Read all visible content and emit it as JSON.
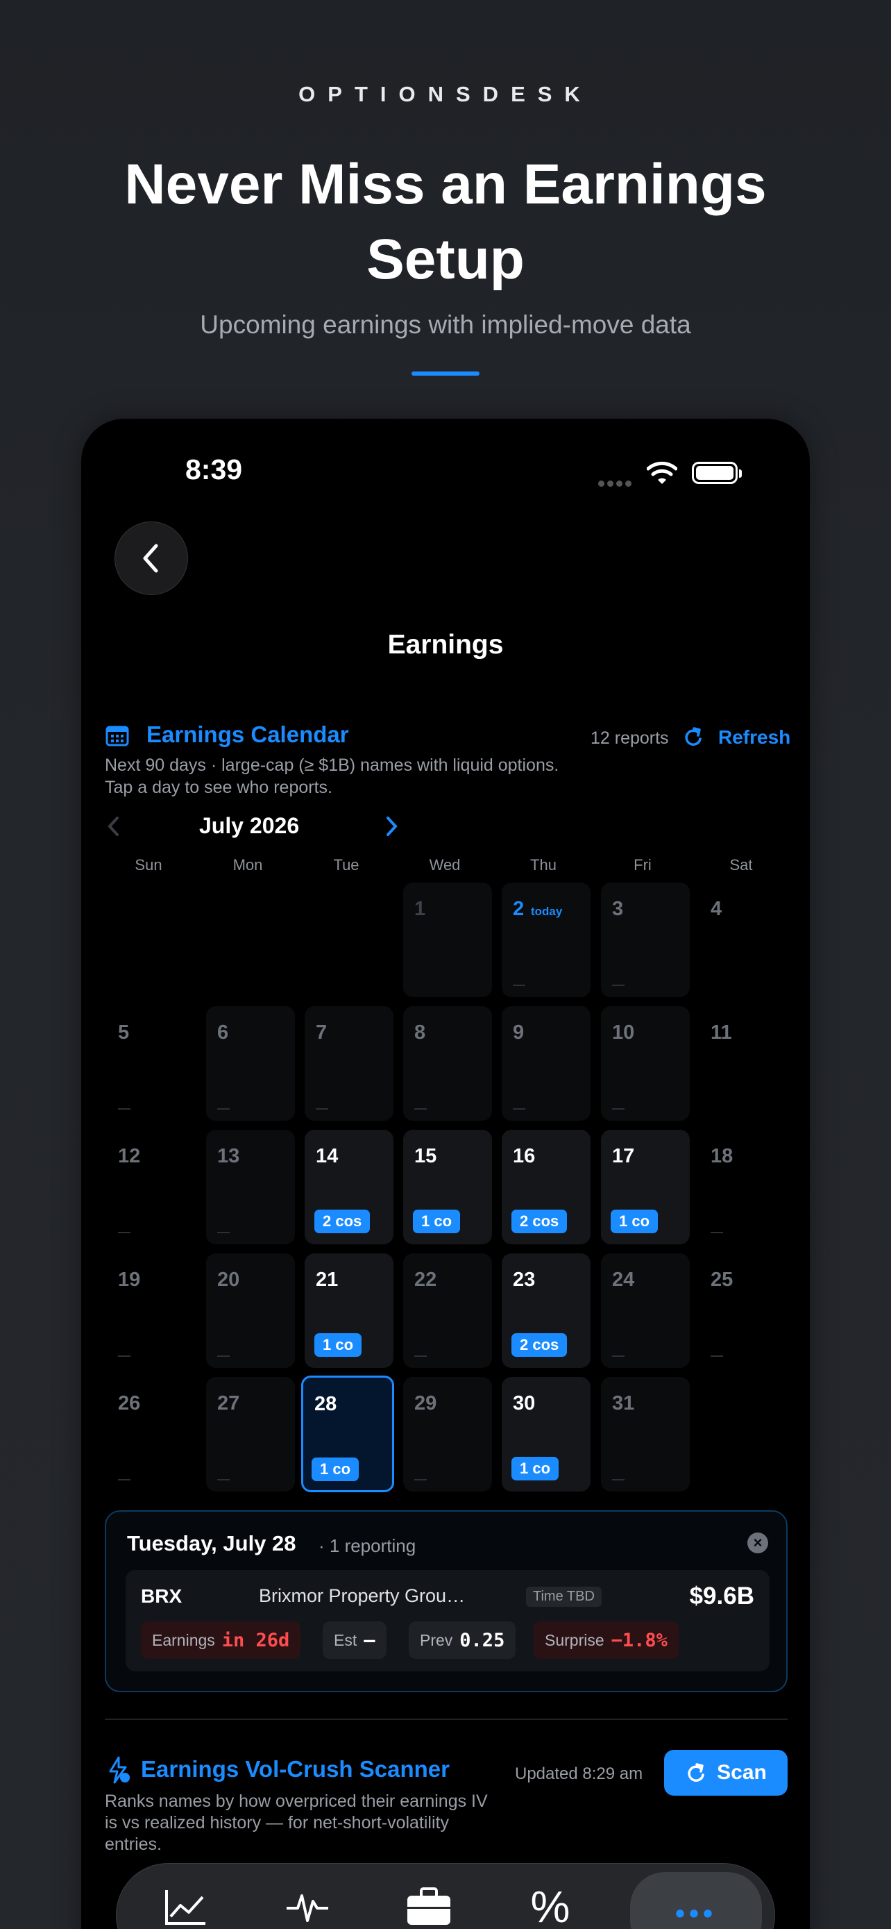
{
  "promo": {
    "brand": "OPTIONSDESK",
    "title": "Never Miss an Earnings Setup",
    "subtitle": "Upcoming earnings with implied-move data"
  },
  "status_bar": {
    "time": "8:39"
  },
  "nav": {
    "title": "Earnings",
    "back_icon": "chevron-left-icon"
  },
  "calendar_section": {
    "icon": "calendar-icon",
    "title": "Earnings Calendar",
    "report_count": "12 reports",
    "refresh_label": "Refresh",
    "description": "Next 90 days · large-cap (≥ $1B) names with liquid options. Tap a day to see who reports.",
    "month_label": "July 2026",
    "weekdays": [
      "Sun",
      "Mon",
      "Tue",
      "Wed",
      "Thu",
      "Fri",
      "Sat"
    ],
    "days": {
      "d1": "1",
      "d2": "2",
      "today_tag": "today",
      "d3": "3",
      "d4": "4",
      "d5": "5",
      "d6": "6",
      "d7": "7",
      "d8": "8",
      "d9": "9",
      "d10": "10",
      "d11": "11",
      "d12": "12",
      "d13": "13",
      "d14": "14",
      "d15": "15",
      "d16": "16",
      "d17": "17",
      "d18": "18",
      "d19": "19",
      "d20": "20",
      "d21": "21",
      "d22": "22",
      "d23": "23",
      "d24": "24",
      "d25": "25",
      "d26": "26",
      "d27": "27",
      "d28": "28",
      "d29": "29",
      "d30": "30",
      "d31": "31"
    },
    "badges": {
      "b14": "2 cos",
      "b15": "1 co",
      "b16": "2 cos",
      "b17": "1 co",
      "b21": "1 co",
      "b23": "2 cos",
      "b28": "1 co",
      "b30": "1 co"
    }
  },
  "day_detail": {
    "date": "Tuesday, July 28",
    "count": "· 1 reporting",
    "close_icon": "close-icon",
    "row": {
      "ticker": "BRX",
      "company": "Brixmor Property Grou…",
      "time": "Time TBD",
      "market_cap": "$9.6B",
      "earnings_label": "Earnings",
      "earnings_value": "in 26d",
      "est_label": "Est",
      "est_value": "—",
      "prev_label": "Prev",
      "prev_value": "0.25",
      "surprise_label": "Surprise",
      "surprise_value": "−1.8%"
    }
  },
  "scanner": {
    "icon": "bolt-icon",
    "title": "Earnings Vol-Crush Scanner",
    "updated": "Updated 8:29 am",
    "scan_label": "Scan",
    "description": "Ranks names by how overpriced their earnings IV is vs realized history — for net-short-volatility entries."
  },
  "tab_bar": {
    "tabs": [
      {
        "icon": "chart-line-icon"
      },
      {
        "icon": "pulse-icon"
      },
      {
        "icon": "briefcase-icon"
      },
      {
        "icon": "percent-icon",
        "label": "%"
      },
      {
        "icon": "more-icon",
        "label": "•••"
      }
    ]
  },
  "colors": {
    "accent": "#1a8cff",
    "negative": "#ff4d4f",
    "background": "#000000"
  }
}
